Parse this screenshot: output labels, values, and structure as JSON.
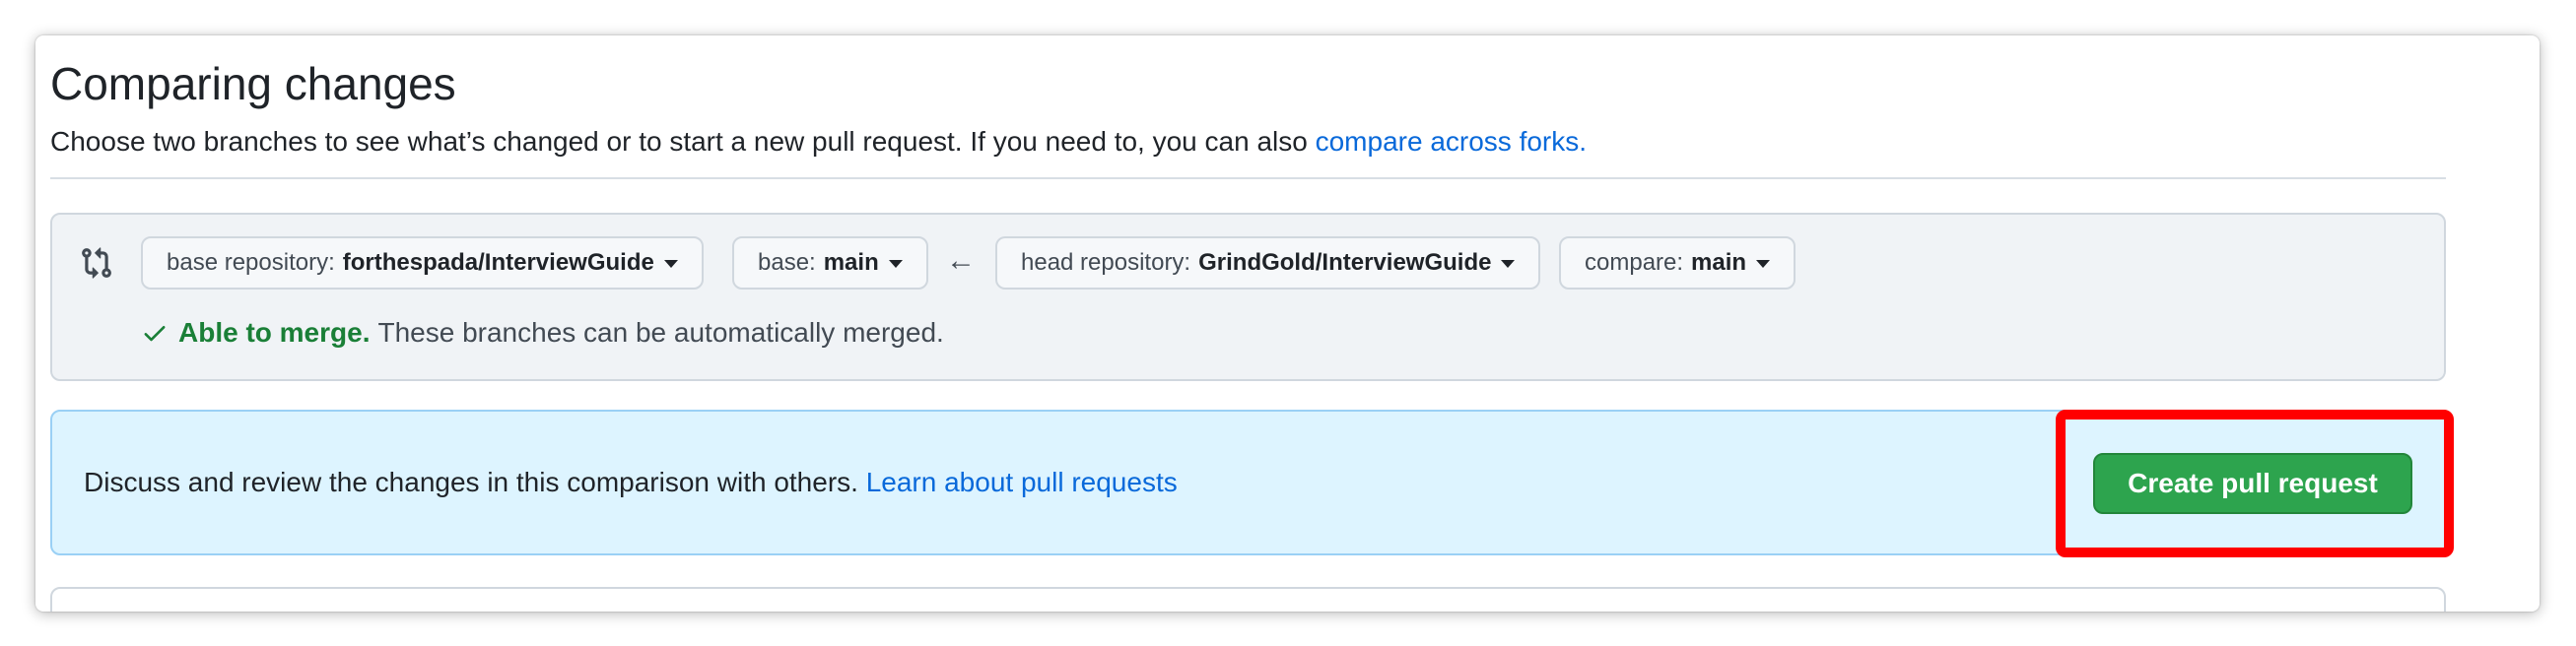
{
  "page": {
    "title": "Comparing changes",
    "subtitle_text": "Choose two branches to see what’s changed or to start a new pull request. If you need to, you can also ",
    "subtitle_link": "compare across forks."
  },
  "range": {
    "icon": "git-compare-icon",
    "base_repo": {
      "label": "base repository:",
      "value": "forthespada/InterviewGuide"
    },
    "base_branch": {
      "label": "base:",
      "value": "main"
    },
    "arrow": "←",
    "head_repo": {
      "label": "head repository:",
      "value": "GrindGold/InterviewGuide"
    },
    "compare_branch": {
      "label": "compare:",
      "value": "main"
    },
    "merge_status": {
      "icon": "check-icon",
      "status": "Able to merge.",
      "description": "These branches can be automatically merged."
    }
  },
  "flash": {
    "text": "Discuss and review the changes in this comparison with others. ",
    "link": "Learn about pull requests",
    "button_label": "Create pull request"
  },
  "colors": {
    "link": "#0969da",
    "success": "#1a7f37",
    "primary_button": "#2da44e",
    "flash_bg": "#ddf4ff",
    "highlight": "#ff0000"
  }
}
